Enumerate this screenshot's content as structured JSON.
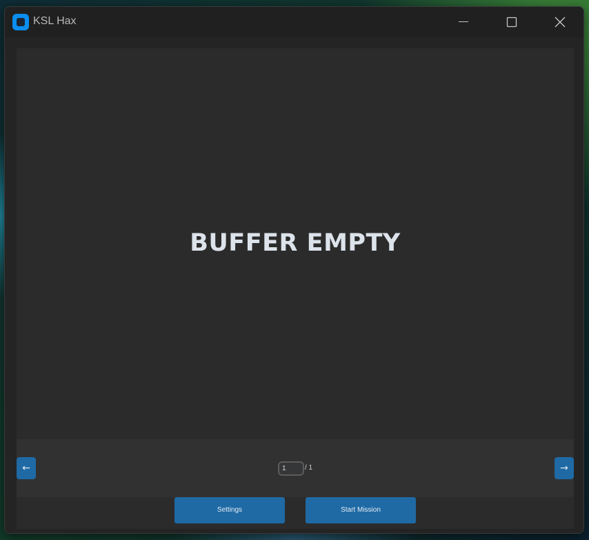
{
  "window": {
    "title": "KSL Hax",
    "icon": "app-logo-icon",
    "controls": {
      "minimize_icon": "minimize-icon",
      "maximize_icon": "maximize-icon",
      "close_icon": "close-icon"
    }
  },
  "display": {
    "message": "BUFFER EMPTY"
  },
  "pager": {
    "prev_label": "←",
    "next_label": "→",
    "current_page": "1",
    "total_label": "/ 1"
  },
  "actions": {
    "settings_label": "Settings",
    "start_label": "Start Mission"
  },
  "colors": {
    "accent": "#1f6aa5",
    "window_bg": "#202020",
    "panel_bg": "#2b2b2b",
    "text": "#dde3ea"
  }
}
